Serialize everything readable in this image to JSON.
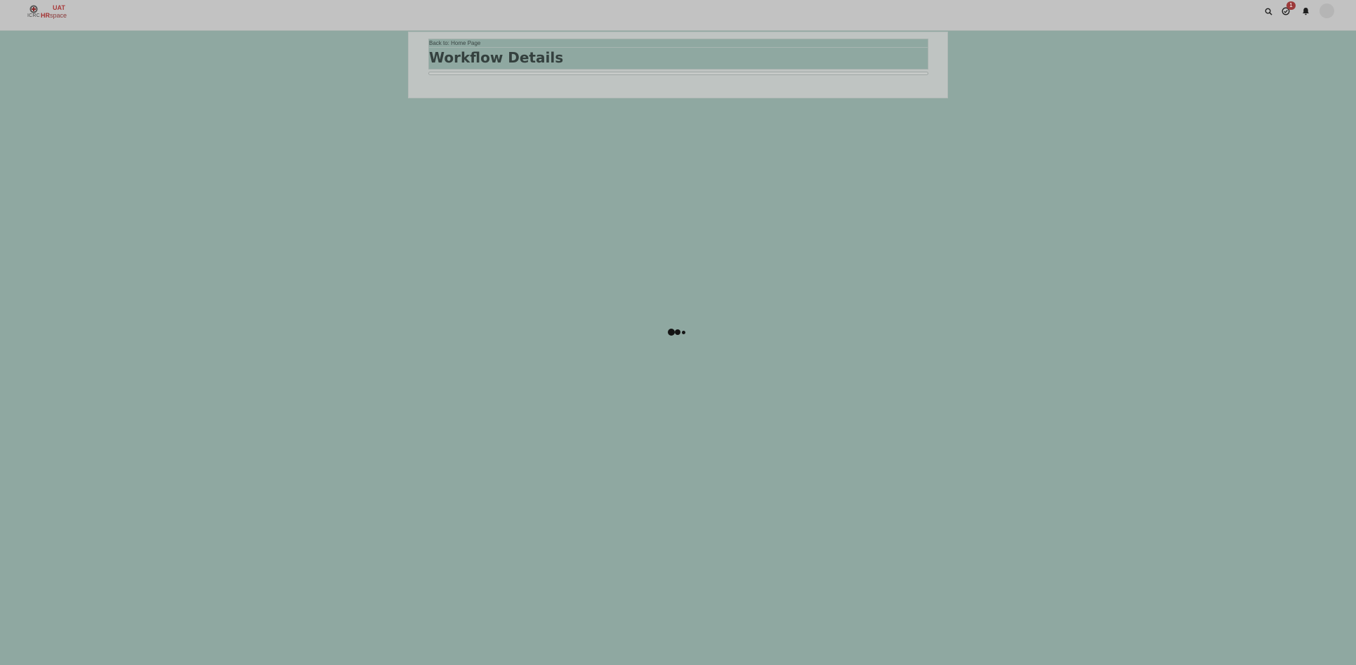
{
  "header": {
    "logo": {
      "sub_text": "ICRC",
      "env_tag": "UAT",
      "app_name_prefix": "HR",
      "app_name_suffix": "space"
    },
    "icons": [
      "search-icon",
      "tasks-check-icon",
      "bell-icon"
    ],
    "tasks_badge_count": "1"
  },
  "main": {
    "back_link": "Back to: Home Page",
    "title": "Workflow Details"
  },
  "colors": {
    "overlay": "#8fa8a1",
    "topbar": "#c2c2c2",
    "badge": "#9c3a3a",
    "brand_red": "#a33030"
  }
}
